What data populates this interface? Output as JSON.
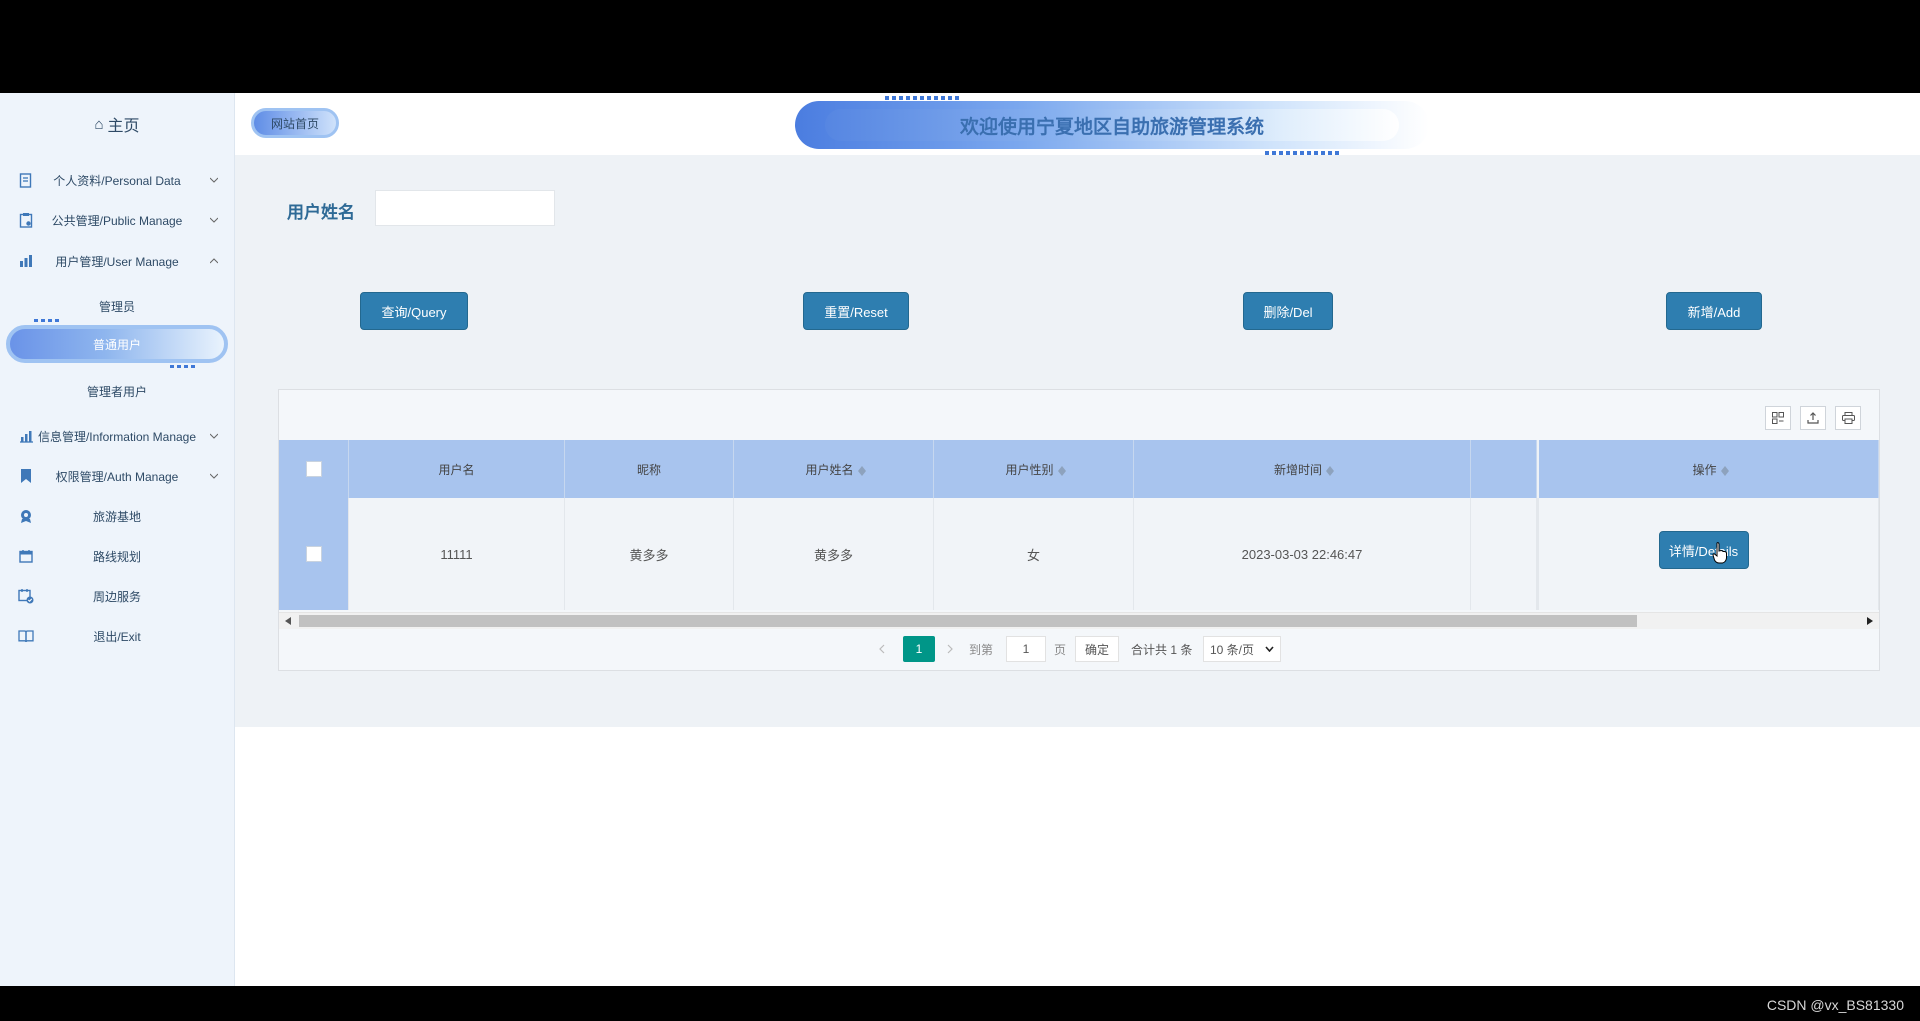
{
  "sidebar": {
    "home_label": "主页",
    "items": [
      {
        "label": "个人资料/Personal Data",
        "icon": "profile-doc-icon"
      },
      {
        "label": "公共管理/Public Manage",
        "icon": "clipboard-icon"
      },
      {
        "label": "用户管理/User Manage",
        "icon": "users-chart-icon"
      },
      {
        "label": "信息管理/Information Manage",
        "icon": "bar-chart-icon"
      },
      {
        "label": "权限管理/Auth Manage",
        "icon": "bookmark-icon"
      },
      {
        "label": "旅游基地",
        "icon": "badge-icon"
      },
      {
        "label": "路线规划",
        "icon": "calendar-icon"
      },
      {
        "label": "周边服务",
        "icon": "calendar-check-icon"
      },
      {
        "label": "退出/Exit",
        "icon": "book-open-icon"
      }
    ],
    "sub_items": [
      "管理员",
      "普通用户",
      "管理者用户"
    ]
  },
  "header": {
    "site_home": "网站首页",
    "title": "欢迎使用宁夏地区自助旅游管理系统"
  },
  "search": {
    "label": "用户姓名",
    "value": ""
  },
  "buttons": {
    "query": "查询/Query",
    "reset": "重置/Reset",
    "delete": "删除/Del",
    "add": "新增/Add"
  },
  "table": {
    "columns": [
      "用户名",
      "昵称",
      "用户姓名",
      "用户性别",
      "新增时间",
      "",
      "操作"
    ],
    "rows": [
      {
        "username": "11111",
        "nickname": "黄多多",
        "name": "黄多多",
        "gender": "女",
        "time": "2023-03-03 22:46:47",
        "action": "详情/Details"
      }
    ]
  },
  "pager": {
    "current": "1",
    "goto_label": "到第",
    "page_input": "1",
    "page_unit": "页",
    "confirm": "确定",
    "total": "合计共 1 条",
    "page_size": "10 条/页"
  },
  "watermark": "CSDN @vx_BS81330",
  "colors": {
    "primary_button": "#2e7eb0",
    "table_header": "#a8c4ee",
    "pager_active": "#009688"
  }
}
